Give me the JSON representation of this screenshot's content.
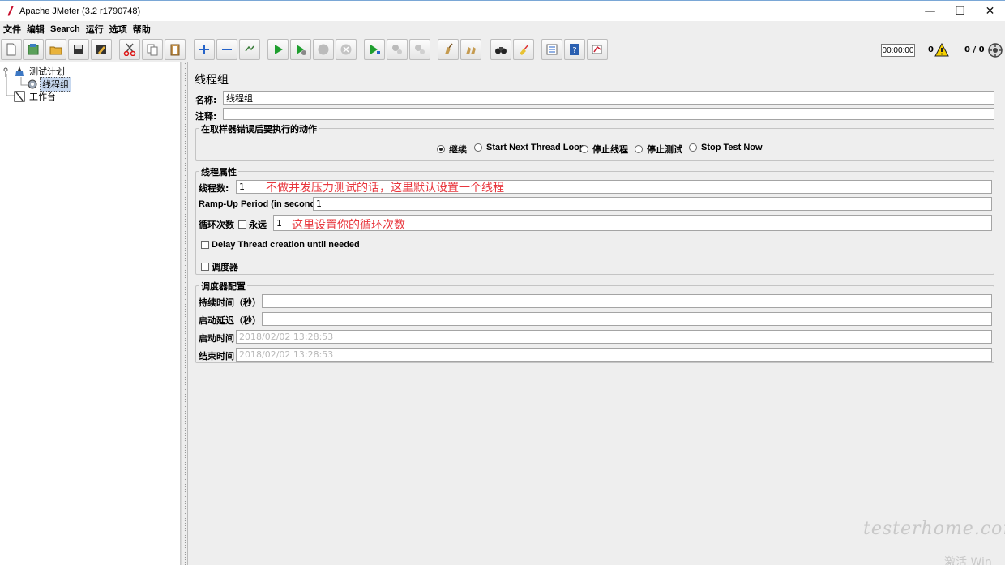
{
  "window": {
    "title": "Apache JMeter (3.2 r1790748)",
    "controls": {
      "minimize": "—",
      "maximize": "☐",
      "close": "✕"
    }
  },
  "menu": [
    "文件",
    "编辑",
    "Search",
    "运行",
    "选项",
    "帮助"
  ],
  "toolbar": {
    "buttons": [
      "new-icon",
      "templates-icon",
      "open-icon",
      "save-icon",
      "save-as-icon",
      "cut-icon",
      "copy-icon",
      "paste-icon",
      "expand-icon",
      "collapse-icon",
      "toggle-icon",
      "start-icon",
      "start-no-pause-icon",
      "stop-icon",
      "shutdown-icon",
      "remote-start-icon",
      "remote-stop-icon",
      "remote-shutdown-icon",
      "clear-icon",
      "clear-all-icon",
      "search-icon",
      "reset-search-icon",
      "function-helper-icon",
      "help-icon",
      "log-viewer-icon"
    ],
    "timer": "00:00:00",
    "warning_count": "0",
    "threads_ratio": "0 / 0"
  },
  "tree": {
    "root": "测试计划",
    "thread_group": "线程组",
    "workbench": "工作台"
  },
  "panel": {
    "title": "线程组",
    "name_label": "名称:",
    "name_value": "线程组",
    "comment_label": "注释:",
    "comment_value": "",
    "on_error": {
      "title": "在取样器错误后要执行的动作",
      "options": [
        "继续",
        "Start Next Thread Loop",
        "停止线程",
        "停止测试",
        "Stop Test Now"
      ],
      "selected": "继续"
    },
    "thread_props": {
      "title": "线程属性",
      "threads_label": "线程数:",
      "threads_value": "1",
      "rampup_label": "Ramp-Up Period (in seconds):",
      "rampup_value": "1",
      "loop_label": "循环次数",
      "forever_label": "永远",
      "loop_value": "1",
      "delay_label": "Delay Thread creation until needed",
      "scheduler_label": "调度器"
    },
    "scheduler": {
      "title": "调度器配置",
      "duration_label": "持续时间（秒）",
      "duration_value": "",
      "delay_label": "启动延迟（秒）",
      "delay_value": "",
      "start_label": "启动时间",
      "start_value": "2018/02/02 13:28:53",
      "end_label": "结束时间",
      "end_value": "2018/02/02 13:28:53"
    },
    "annotations": {
      "threads_note": "不做并发压力测试的话，这里默认设置一个线程",
      "loop_note": "这里设置你的循环次数"
    }
  },
  "watermark": {
    "main": "testerhome.com",
    "sub": "激活 Win"
  }
}
